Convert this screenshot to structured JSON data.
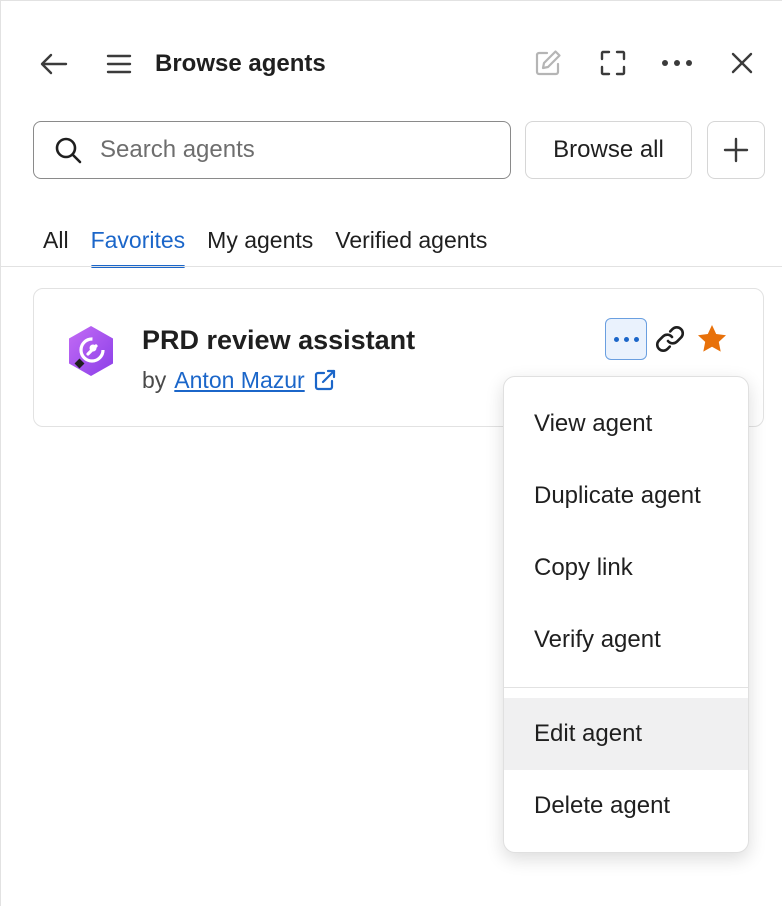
{
  "header": {
    "title": "Browse agents",
    "icons": [
      "arrow-left-icon",
      "hamburger-menu-icon",
      "edit-icon",
      "fullscreen-icon",
      "more-horizontal-icon",
      "close-icon"
    ]
  },
  "search": {
    "placeholder": "Search agents",
    "value": ""
  },
  "toolbar": {
    "browse_all_label": "Browse all",
    "add_icon": "plus-icon"
  },
  "tabs": [
    {
      "label": "All",
      "active": false
    },
    {
      "label": "Favorites",
      "active": true
    },
    {
      "label": "My agents",
      "active": false
    },
    {
      "label": "Verified agents",
      "active": false
    }
  ],
  "agent_card": {
    "name": "PRD review assistant",
    "by_prefix": "by",
    "author": "Anton Mazur",
    "icon": "purple-hexagon-agent-icon",
    "actions": [
      "more-options-icon",
      "link-icon",
      "star-icon"
    ],
    "favorited": true
  },
  "menu": {
    "items": [
      {
        "label": "View agent"
      },
      {
        "label": "Duplicate agent"
      },
      {
        "label": "Copy link"
      },
      {
        "label": "Verify agent"
      },
      {
        "label": "Edit agent",
        "highlighted": true
      },
      {
        "label": "Delete agent"
      }
    ]
  },
  "colors": {
    "accent": "#1b66c9",
    "star": "#e8710a",
    "agent_icon": "#a855f7",
    "menu_hover": "#f0f0f1"
  }
}
